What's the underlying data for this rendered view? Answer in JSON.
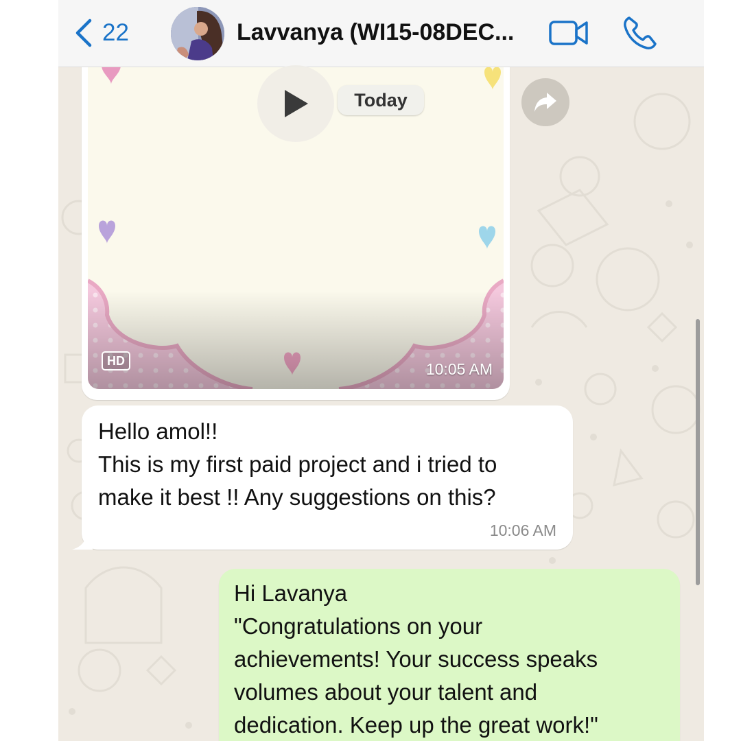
{
  "header": {
    "back_count": "22",
    "contact_name": "Lavvanya (WI15-08DEC..."
  },
  "media": {
    "date_label": "Today",
    "hd_label": "HD",
    "time": "10:05 AM"
  },
  "messages": [
    {
      "direction": "incoming",
      "text": "Hello amol!!\nThis is my first paid project and i tried to\nmake it best !! Any suggestions on this?",
      "time": "10:06 AM"
    },
    {
      "direction": "outgoing",
      "text": "Hi Lavanya\n \"Congratulations on your\nachievements! Your success speaks\nvolumes about your talent and\ndedication. Keep up the great work!\""
    }
  ],
  "icons": {
    "back": "chevron-left-icon",
    "video": "video-camera-icon",
    "call": "phone-icon",
    "play": "play-icon",
    "forward": "forward-icon"
  },
  "colors": {
    "accent": "#1a73c8",
    "wallpaper": "#efeae2",
    "outgoing_bubble": "#dcf8c6",
    "incoming_bubble": "#ffffff"
  }
}
